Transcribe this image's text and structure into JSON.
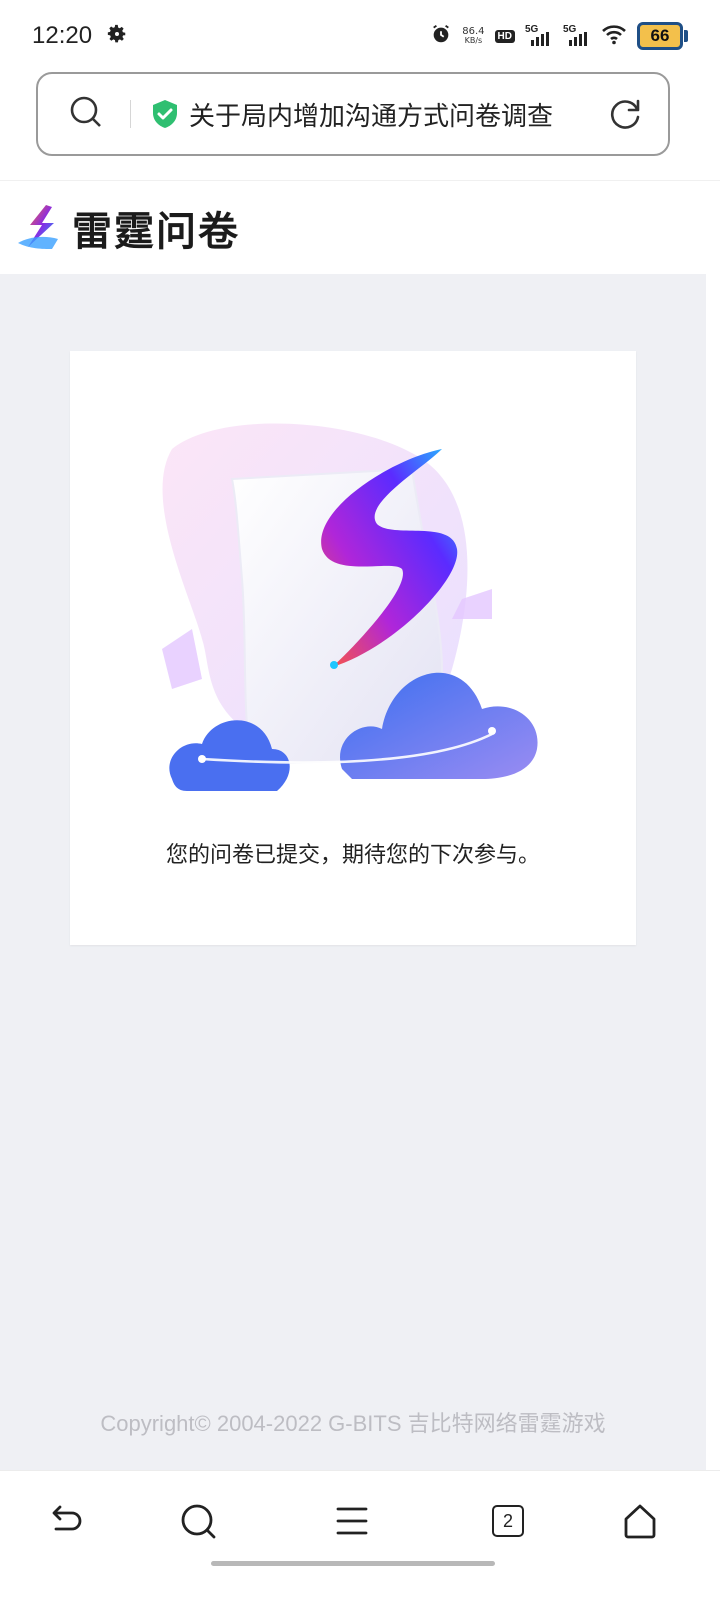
{
  "status_bar": {
    "time": "12:20",
    "net_speed_value": "86.4",
    "net_speed_unit": "KB/s",
    "hd_label": "HD",
    "signal_1_label": "5G",
    "signal_2_label": "5G",
    "battery_level": "66",
    "icons": [
      "settings-gear-icon",
      "alarm-icon",
      "hd-icon",
      "signal-icon",
      "signal-icon",
      "wifi-icon",
      "battery-icon"
    ]
  },
  "url_bar": {
    "title": "关于局内增加沟通方式问卷调查",
    "secure": true
  },
  "site": {
    "logo_text": "雷霆问卷"
  },
  "card": {
    "message": "您的问卷已提交，期待您的下次参与。"
  },
  "footer": {
    "copyright": "Copyright© 2004-2022 G-BITS 吉比特网络雷霆游戏"
  },
  "bottom_nav": {
    "tabs_count": "2",
    "items": [
      "back-icon",
      "search-icon",
      "menu-icon",
      "tabs-icon",
      "home-icon"
    ]
  },
  "colors": {
    "page_background": "#eff0f4",
    "secure_shield": "#2fbf71",
    "battery_fill": "#f3c04b",
    "battery_frame": "#1f4f86",
    "copyright_text": "#bdbdc3"
  }
}
